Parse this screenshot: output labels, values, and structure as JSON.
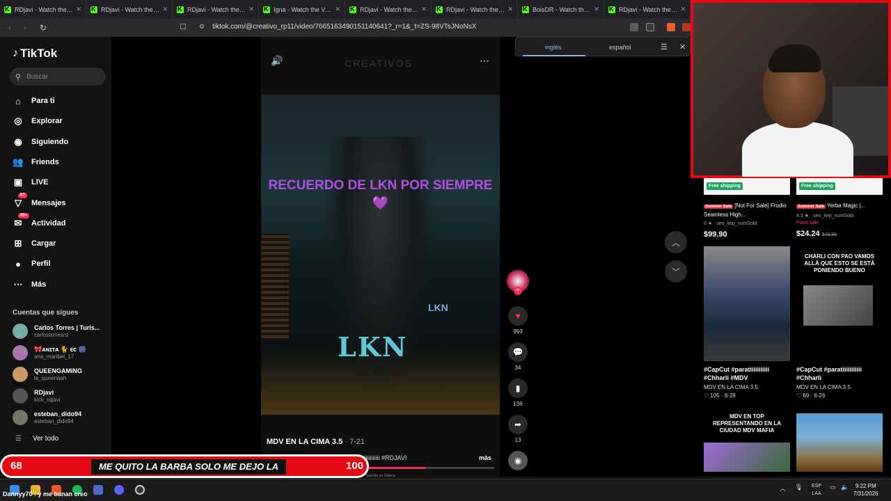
{
  "browser": {
    "tabs": [
      "RDjavi - Watch the VOD c",
      "RDjavi - Watch the VOD c",
      "RDjavi - Watch the VOD c",
      "Igna - Watch the VOD on",
      "RDjavi - Watch the VOD c",
      "RDjavi - Watch the VOD c",
      "BoisDR - Watch the VOD",
      "RDjavi - Watch the VOD c"
    ],
    "url": "tiktok.com/@creativo_rp11/video/7665163490151140641?_r=1&_t=ZS-98VTsJNoNsX"
  },
  "translate": {
    "lang1": "inglés",
    "lang2": "español"
  },
  "sidebar": {
    "logo": "TikTok",
    "search_placeholder": "Buscar",
    "nav": [
      {
        "label": "Para ti",
        "icon": "home-icon"
      },
      {
        "label": "Explorar",
        "icon": "compass-icon"
      },
      {
        "label": "Siguiendo",
        "icon": "following-icon"
      },
      {
        "label": "Friends",
        "icon": "friends-icon"
      },
      {
        "label": "LIVE",
        "icon": "live-icon"
      },
      {
        "label": "Mensajes",
        "icon": "messages-icon",
        "badge": "67"
      },
      {
        "label": "Actividad",
        "icon": "activity-icon",
        "badge": "99+"
      },
      {
        "label": "Cargar",
        "icon": "upload-icon"
      },
      {
        "label": "Perfil",
        "icon": "profile-icon"
      },
      {
        "label": "Más",
        "icon": "more-icon"
      }
    ],
    "following_title": "Cuentas que sigues",
    "following": [
      {
        "name": "Carlos Torres | Turis...",
        "handle": "carlostorresrd",
        "color": "#7aa"
      },
      {
        "name": "🎀ᴀɴɪᴛᴀ 🐈 ᴇᴄ 🎆",
        "handle": "ana_maribel_17",
        "color": "#a7a"
      },
      {
        "name": "QUEENGAMING",
        "handle": "la_queenaah",
        "color": "#c96"
      },
      {
        "name": "RDjavi",
        "handle": "kick_rdjavi",
        "color": "#555"
      },
      {
        "name": "esteban_dido94",
        "handle": "esteban_dido94",
        "color": "#776"
      }
    ],
    "see_all": "Ver todo"
  },
  "video": {
    "overlay_text": "RECUERDO DE LKN POR SIEMPRE 💜",
    "shirt_text": "LKN",
    "author": "MDV EN LA CIMA 3.5",
    "date": "· 7-21",
    "description": "LKN UNA DE LA MEJORES #paratiiiiiiiiiii #RDJAVI",
    "more": "más",
    "gallery": "Guardar en Galería",
    "likes": "993",
    "comments": "34",
    "saves": "136",
    "shares": "13"
  },
  "right": {
    "products": [
      {
        "ship": "Free shipping",
        "sale": "Summer Sale",
        "title": "[Not For Sale] Frodio Seamless High...",
        "rating": "0 ★ · seo_kep_numSold",
        "price": "$99.90"
      },
      {
        "ship": "Free shipping",
        "sale": "Summer Sale",
        "title": "Yerba Magic |...",
        "rating": "4.3 ★ · seo_kep_numSold",
        "flash": "Flash sale",
        "price": "$24.24",
        "old_price": "$49.99"
      }
    ],
    "videos": [
      {
        "title": "#CapCut #paratiiiiiiiiiii #Chharli #MDV",
        "sub": "MDV EN LA CIMA 3.5",
        "meta": "♡ 105 · 6-28"
      },
      {
        "overlay": "CHARLI CON PAO VAMOS ALLÁ QUE ESTO SE ESTÁ PONIENDO BUENO",
        "title": "#CapCut #paratiiiiiiiiiii #Chharli",
        "sub": "MDV EN LA CIMA 3.5",
        "meta": "♡ 69 · 6-26"
      },
      {
        "overlay": "MDV EN TOP REPRESENTANDO EN LA CIUDAD MDV MAFIA"
      },
      {}
    ]
  },
  "stream": {
    "left": "68",
    "message": "ME QUITO LA BARBA SOLO ME DEJO LA CHIVA",
    "right": "100",
    "chat": "Dannyy70 : y me banan creo"
  },
  "taskbar": {
    "lang1": "ESP",
    "lang2": "LAA",
    "time": "9:22 PM",
    "date": "7/31/2026"
  },
  "progress": 0.45
}
